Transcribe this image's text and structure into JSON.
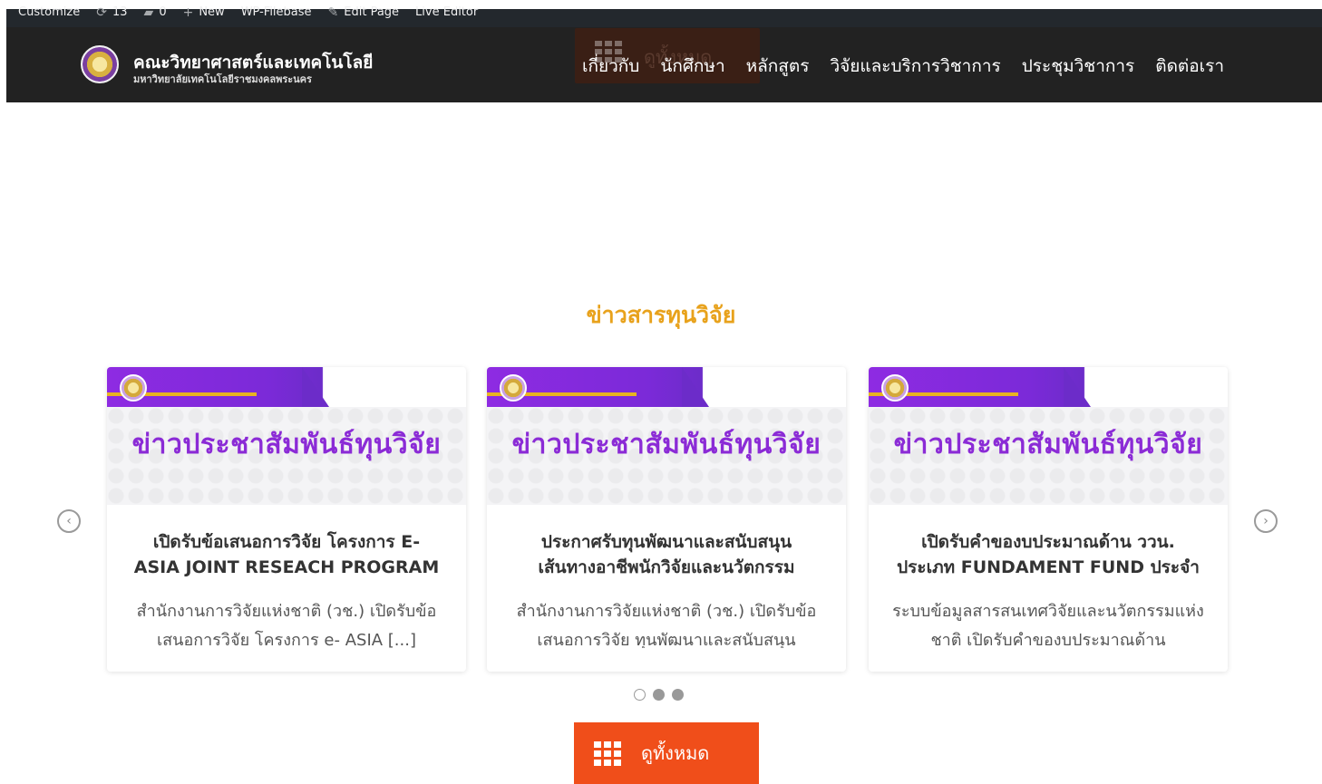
{
  "admin_bar": {
    "items": [
      {
        "icon": "",
        "label": "Customize"
      },
      {
        "icon": "refresh-icon",
        "label": "13"
      },
      {
        "icon": "comment-icon",
        "label": "0"
      },
      {
        "icon": "plus-icon",
        "label": "New"
      },
      {
        "icon": "",
        "label": "WP-Filebase"
      },
      {
        "icon": "pencil-icon",
        "label": "Edit Page"
      },
      {
        "icon": "",
        "label": "Live Editor"
      }
    ]
  },
  "header": {
    "brand_title": "คณะวิทยาศาสตร์และเทคโนโลยี",
    "brand_subtitle": "มหาวิทยาลัยเทคโนโลยีราชมงคลพระนคร",
    "nav": [
      "เกี่ยวกับ",
      "นักศึกษา",
      "หลักสูตร",
      "วิจัยและบริการวิชาการ",
      "ประชุมวิชาการ",
      "ติดต่อเรา"
    ],
    "ghost_button_label": "ดูทั้งหมด"
  },
  "section": {
    "title": "ข่าวสารทุนวิจัย"
  },
  "cards": [
    {
      "banner_text": "ข่าวประชาสัมพันธ์ทุนวิจัย",
      "title": "เปิดรับข้อเสนอการวิจัย โครงการ E-\nASIA JOINT RESEACH PROGRAM",
      "excerpt": "สำนักงานการวิจัยแห่งชาติ (วช.) เปิดรับข้อเสนอการวิจัย โครงการ e- ASIA [...]"
    },
    {
      "banner_text": "ข่าวประชาสัมพันธ์ทุนวิจัย",
      "title": "ประกาศรับทุนพัฒนาและสนับสนุน\nเส้นทางอาชีพนักวิจัยและนวัตกรรม",
      "excerpt": "สำนักงานการวิจัยแห่งชาติ (วช.) เปิดรับข้อเสนอการวิจัย ทุนพัฒนาและสนับสนุน"
    },
    {
      "banner_text": "ข่าวประชาสัมพันธ์ทุนวิจัย",
      "title": "เปิดรับคำของบประมาณด้าน ววน.\nประเภท FUNDAMENT FUND ประจำ",
      "excerpt": "ระบบข้อมูลสารสนเทศวิจัยและนวัตกรรมแห่งชาติ เปิดรับคำของบประมาณด้าน"
    }
  ],
  "carousel": {
    "prev_icon": "chevron-left-icon",
    "next_icon": "chevron-right-icon",
    "pages": 3,
    "active_page": 1
  },
  "view_all": {
    "label": "ดูทั้งหมด",
    "icon": "grid-icon"
  },
  "colors": {
    "accent_orange": "#f04e1a",
    "section_title": "#e8a21c",
    "banner_purple": "#8b2bd6",
    "header_bg": "#222222"
  }
}
